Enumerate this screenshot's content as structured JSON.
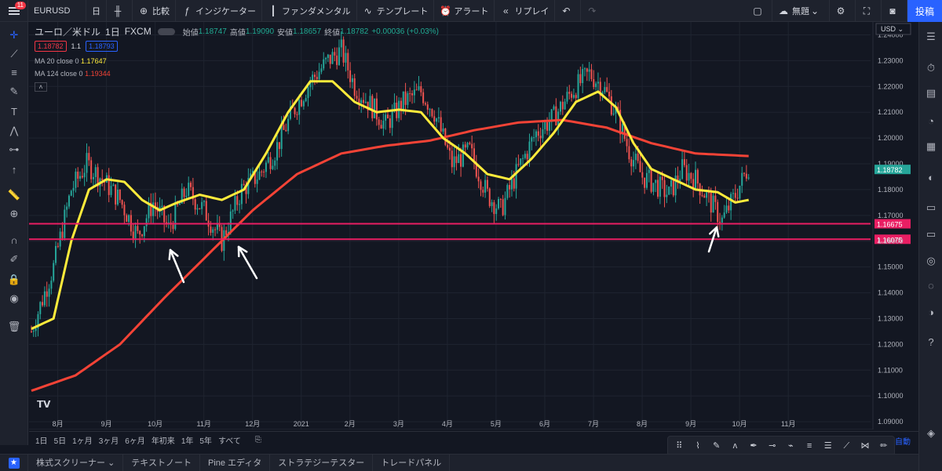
{
  "topbar": {
    "notif_count": "11",
    "symbol": "EURUSD",
    "interval": "日",
    "compare": "比較",
    "indicators": "インジケーター",
    "fundamental": "ファンダメンタル",
    "template": "テンプレート",
    "alert": "アラート",
    "replay": "リプレイ",
    "layout_name": "無題",
    "post": "投稿"
  },
  "legend": {
    "title": "ユーロ／米ドル",
    "interval": "1日",
    "broker": "FXCM",
    "open_label": "始値",
    "open": "1.18747",
    "high_label": "高値",
    "high": "1.19090",
    "low_label": "安値",
    "low": "1.18657",
    "close_label": "終値",
    "close": "1.18782",
    "change": "+0.00036 (+0.03%)",
    "bid": "1.18782",
    "spread": "1.1",
    "ask": "1.18793",
    "ma1_label": "MA 20 close 0",
    "ma1_value": "1.17647",
    "ma2_label": "MA 124 close 0",
    "ma2_value": "1.19344"
  },
  "colors": {
    "background": "#131722",
    "up": "#26a69a",
    "down": "#ef5350",
    "ma20": "#ffeb3b",
    "ma124": "#f44336",
    "hline": "#e91e63"
  },
  "chart_data": {
    "type": "candlestick",
    "currency": "USD",
    "y_ticks": [
      "1.24000",
      "1.23000",
      "1.22000",
      "1.21000",
      "1.20000",
      "1.19000",
      "1.18000",
      "1.17000",
      "1.16000",
      "1.15000",
      "1.14000",
      "1.13000",
      "1.12000",
      "1.11000",
      "1.10000",
      "1.09000"
    ],
    "y_range": [
      1.087,
      1.245
    ],
    "x_ticks": [
      "8月",
      "9月",
      "10月",
      "11月",
      "12月",
      "2021",
      "2月",
      "3月",
      "4月",
      "5月",
      "6月",
      "7月",
      "8月",
      "9月",
      "10月",
      "11月"
    ],
    "current_price": "1.18782",
    "hlines": [
      {
        "label": "1.16675",
        "value": 1.16675
      },
      {
        "label": "1.16075",
        "value": 1.16075
      }
    ],
    "price_keypoints": [
      [
        0,
        1.125
      ],
      [
        10,
        1.15
      ],
      [
        18,
        1.18
      ],
      [
        25,
        1.19
      ],
      [
        32,
        1.184
      ],
      [
        40,
        1.176
      ],
      [
        48,
        1.162
      ],
      [
        55,
        1.175
      ],
      [
        62,
        1.165
      ],
      [
        70,
        1.18
      ],
      [
        78,
        1.172
      ],
      [
        86,
        1.16
      ],
      [
        95,
        1.18
      ],
      [
        103,
        1.186
      ],
      [
        110,
        1.195
      ],
      [
        118,
        1.21
      ],
      [
        126,
        1.222
      ],
      [
        134,
        1.23
      ],
      [
        140,
        1.234
      ],
      [
        146,
        1.22
      ],
      [
        154,
        1.212
      ],
      [
        160,
        1.205
      ],
      [
        168,
        1.214
      ],
      [
        176,
        1.218
      ],
      [
        182,
        1.21
      ],
      [
        190,
        1.19
      ],
      [
        198,
        1.195
      ],
      [
        206,
        1.178
      ],
      [
        212,
        1.172
      ],
      [
        220,
        1.188
      ],
      [
        228,
        1.202
      ],
      [
        236,
        1.208
      ],
      [
        244,
        1.218
      ],
      [
        252,
        1.225
      ],
      [
        258,
        1.22
      ],
      [
        264,
        1.21
      ],
      [
        270,
        1.195
      ],
      [
        276,
        1.185
      ],
      [
        282,
        1.182
      ],
      [
        288,
        1.178
      ],
      [
        294,
        1.188
      ],
      [
        300,
        1.184
      ],
      [
        306,
        1.176
      ],
      [
        312,
        1.168
      ],
      [
        318,
        1.178
      ],
      [
        324,
        1.189
      ]
    ],
    "ma20_keypoints": [
      [
        0,
        1.126
      ],
      [
        10,
        1.13
      ],
      [
        18,
        1.16
      ],
      [
        26,
        1.18
      ],
      [
        34,
        1.184
      ],
      [
        42,
        1.183
      ],
      [
        50,
        1.176
      ],
      [
        58,
        1.172
      ],
      [
        66,
        1.175
      ],
      [
        76,
        1.178
      ],
      [
        86,
        1.176
      ],
      [
        96,
        1.18
      ],
      [
        106,
        1.194
      ],
      [
        116,
        1.21
      ],
      [
        126,
        1.222
      ],
      [
        136,
        1.222
      ],
      [
        146,
        1.214
      ],
      [
        156,
        1.21
      ],
      [
        166,
        1.211
      ],
      [
        176,
        1.21
      ],
      [
        186,
        1.2
      ],
      [
        196,
        1.194
      ],
      [
        206,
        1.186
      ],
      [
        216,
        1.184
      ],
      [
        226,
        1.192
      ],
      [
        236,
        1.202
      ],
      [
        246,
        1.214
      ],
      [
        256,
        1.218
      ],
      [
        264,
        1.212
      ],
      [
        272,
        1.198
      ],
      [
        280,
        1.188
      ],
      [
        290,
        1.184
      ],
      [
        300,
        1.18
      ],
      [
        310,
        1.179
      ],
      [
        318,
        1.175
      ],
      [
        324,
        1.176
      ]
    ],
    "ma124_keypoints": [
      [
        0,
        1.102
      ],
      [
        20,
        1.108
      ],
      [
        40,
        1.12
      ],
      [
        60,
        1.138
      ],
      [
        80,
        1.155
      ],
      [
        100,
        1.172
      ],
      [
        120,
        1.186
      ],
      [
        140,
        1.194
      ],
      [
        160,
        1.197
      ],
      [
        180,
        1.199
      ],
      [
        200,
        1.203
      ],
      [
        220,
        1.206
      ],
      [
        240,
        1.207
      ],
      [
        260,
        1.204
      ],
      [
        280,
        1.198
      ],
      [
        300,
        1.194
      ],
      [
        324,
        1.193
      ]
    ]
  },
  "timeframes": [
    "1日",
    "5日",
    "1ヶ月",
    "3ヶ月",
    "6ヶ月",
    "年初来",
    "1年",
    "5年",
    "すべて"
  ],
  "auto_label": "自動",
  "bottom_tabs": [
    "株式スクリーナー",
    "テキストノート",
    "Pine エディタ",
    "ストラテジーテスター",
    "トレードパネル"
  ],
  "icons": {
    "left": [
      "crosshair-icon",
      "trend-line-icon",
      "fib-icon",
      "brush-icon",
      "text-icon",
      "pattern-icon",
      "forecast-icon",
      "arrow-icon",
      "ruler-icon",
      "zoom-icon",
      "magnet-icon",
      "stay-drawing-icon",
      "lock-icon",
      "eye-icon",
      "trash-icon"
    ],
    "right": [
      "watchlist-icon",
      "alerts-icon",
      "data-window-icon",
      "hotlist-icon",
      "calendar-icon",
      "ideas-icon",
      "chats-icon",
      "streams-icon",
      "signals-icon",
      "order-panel-icon",
      "help-icon"
    ]
  }
}
